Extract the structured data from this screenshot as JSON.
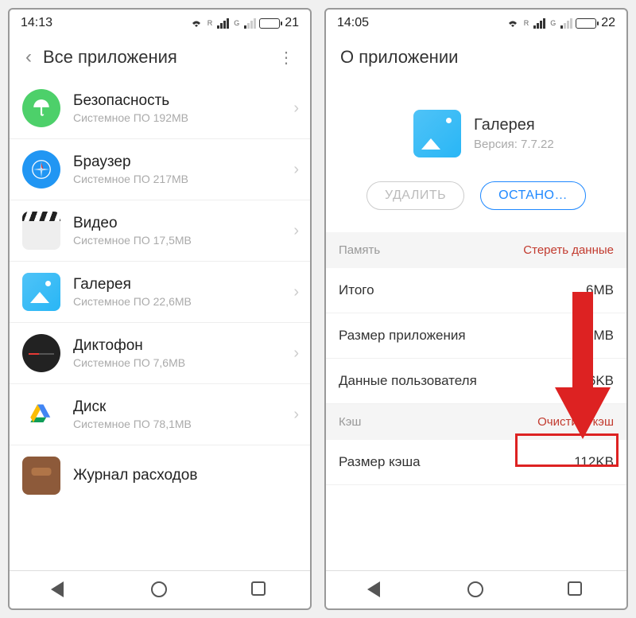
{
  "left": {
    "status": {
      "time": "14:13",
      "battery_pct": "21"
    },
    "header": {
      "title": "Все приложения"
    },
    "apps": [
      {
        "name": "Безопасность",
        "sub": "Системное ПО   192MB"
      },
      {
        "name": "Браузер",
        "sub": "Системное ПО   217MB"
      },
      {
        "name": "Видео",
        "sub": "Системное ПО   17,5MB"
      },
      {
        "name": "Галерея",
        "sub": "Системное ПО   22,6MB"
      },
      {
        "name": "Диктофон",
        "sub": "Системное ПО   7,6MB"
      },
      {
        "name": "Диск",
        "sub": "Системное ПО   78,1MB"
      },
      {
        "name": "Журнал расходов",
        "sub": ""
      }
    ]
  },
  "right": {
    "status": {
      "time": "14:05",
      "battery_pct": "22"
    },
    "header": {
      "title": "О приложении"
    },
    "app": {
      "name": "Галерея",
      "version": "Версия: 7.7.22"
    },
    "buttons": {
      "uninstall": "УДАЛИТЬ",
      "stop": "ОСТАНО…"
    },
    "memory": {
      "section": "Память",
      "action": "Стереть данные",
      "rows": [
        {
          "label": "Итого",
          "value": "6MB"
        },
        {
          "label": "Размер приложения",
          "value": "MB"
        },
        {
          "label": "Данные пользователя",
          "value": "96KB"
        }
      ]
    },
    "cache": {
      "section": "Кэш",
      "action": "Очистить кэш",
      "rows": [
        {
          "label": "Размер кэша",
          "value": "112KB"
        }
      ]
    }
  }
}
